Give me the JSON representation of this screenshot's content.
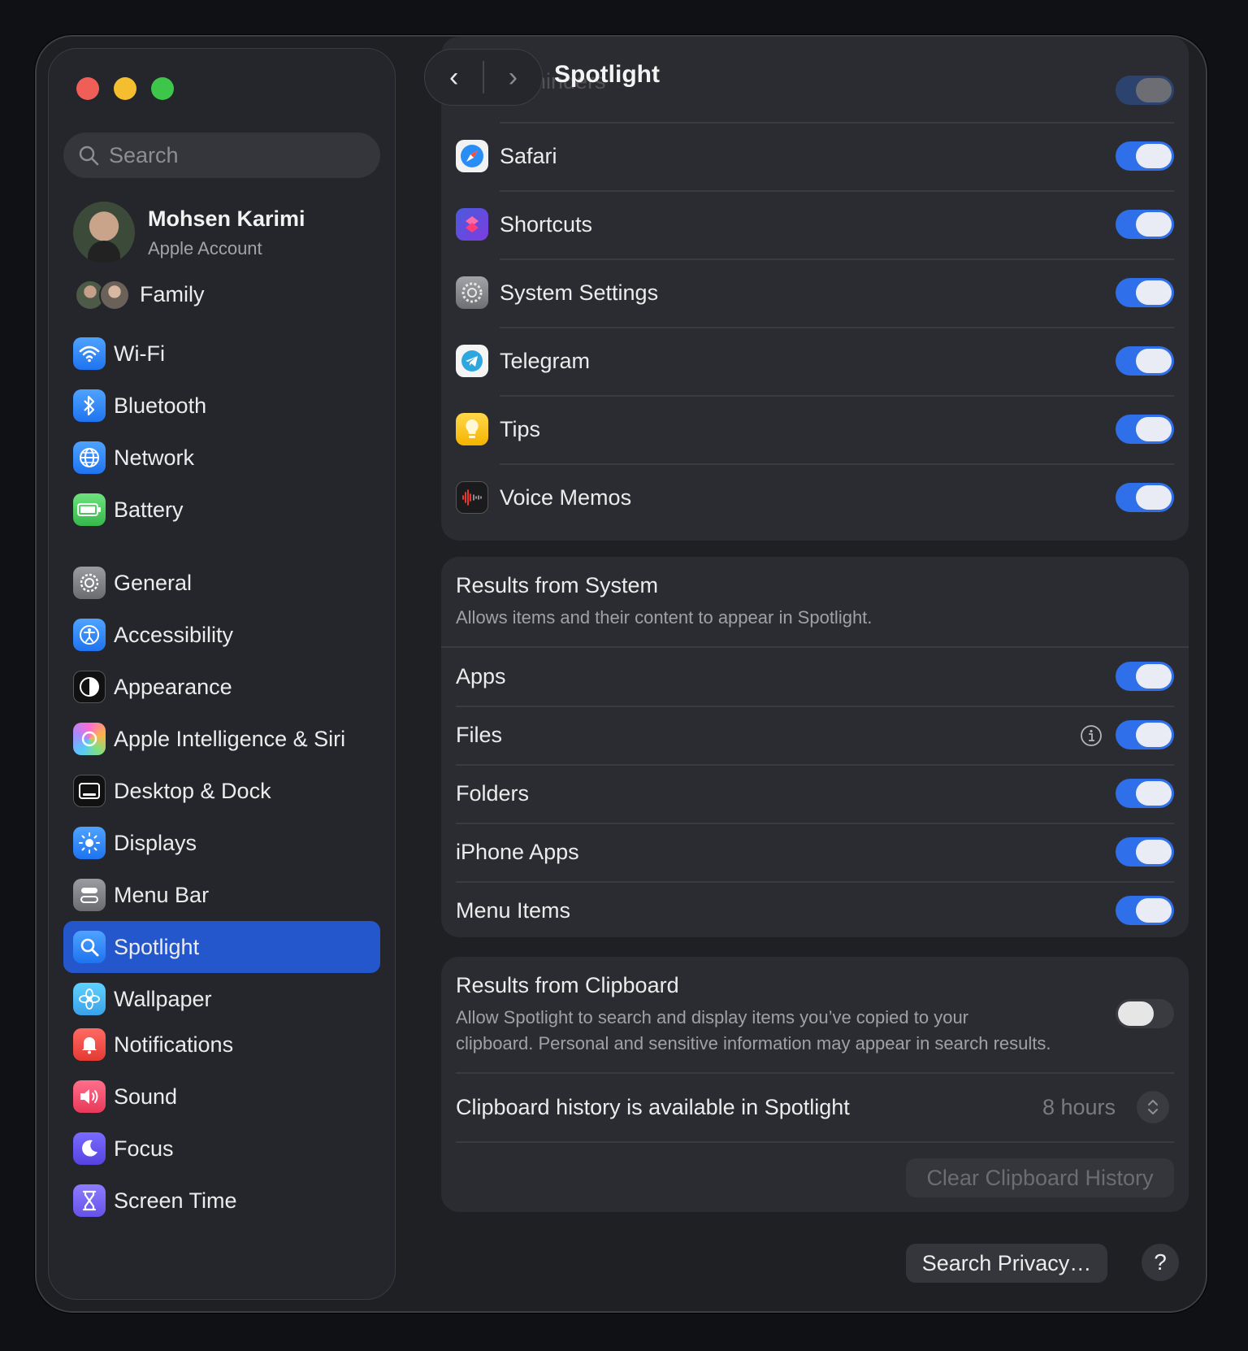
{
  "window": {
    "title": "Spotlight",
    "back_glyph": "‹",
    "forward_glyph": "›"
  },
  "sidebar": {
    "search_placeholder": "Search",
    "account": {
      "name": "Mohsen Karimi",
      "subtitle": "Apple Account"
    },
    "family_label": "Family",
    "groups": [
      [
        {
          "label": "Wi-Fi",
          "icon": "wifi-icon"
        },
        {
          "label": "Bluetooth",
          "icon": "bluetooth-icon"
        },
        {
          "label": "Network",
          "icon": "globe-icon"
        },
        {
          "label": "Battery",
          "icon": "battery-icon"
        }
      ],
      [
        {
          "label": "General",
          "icon": "gear-icon"
        },
        {
          "label": "Accessibility",
          "icon": "accessibility-icon"
        },
        {
          "label": "Appearance",
          "icon": "appearance-icon"
        },
        {
          "label": "Apple Intelligence & Siri",
          "icon": "siri-icon"
        },
        {
          "label": "Desktop & Dock",
          "icon": "dock-icon"
        },
        {
          "label": "Displays",
          "icon": "sun-icon"
        },
        {
          "label": "Menu Bar",
          "icon": "menubar-icon"
        },
        {
          "label": "Spotlight",
          "icon": "magnifier-icon",
          "active": true
        },
        {
          "label": "Wallpaper",
          "icon": "flower-icon"
        }
      ],
      [
        {
          "label": "Notifications",
          "icon": "bell-icon"
        },
        {
          "label": "Sound",
          "icon": "speaker-icon"
        },
        {
          "label": "Focus",
          "icon": "moon-icon"
        },
        {
          "label": "Screen Time",
          "icon": "hourglass-icon"
        }
      ]
    ]
  },
  "apps": {
    "partial_row": "Reminders",
    "items": [
      {
        "label": "Safari",
        "on": true,
        "icon": "safari-icon"
      },
      {
        "label": "Shortcuts",
        "on": true,
        "icon": "shortcuts-icon"
      },
      {
        "label": "System Settings",
        "on": true,
        "icon": "system-settings-icon"
      },
      {
        "label": "Telegram",
        "on": true,
        "icon": "telegram-icon"
      },
      {
        "label": "Tips",
        "on": true,
        "icon": "tips-icon"
      },
      {
        "label": "Voice Memos",
        "on": true,
        "icon": "voice-memos-icon"
      }
    ]
  },
  "system": {
    "title": "Results from System",
    "subtitle": "Allows items and their content to appear in Spotlight.",
    "items": [
      {
        "label": "Apps",
        "on": true
      },
      {
        "label": "Files",
        "on": true,
        "info": true
      },
      {
        "label": "Folders",
        "on": true
      },
      {
        "label": "iPhone Apps",
        "on": true
      },
      {
        "label": "Menu Items",
        "on": true
      }
    ]
  },
  "clipboard": {
    "title": "Results from Clipboard",
    "subtitle_line1": "Allow Spotlight to search and display items you’ve copied to your",
    "subtitle_line2": "clipboard. Personal and sensitive information may appear in search results.",
    "enabled": false,
    "history_label": "Clipboard history is available in Spotlight",
    "history_value": "8 hours",
    "clear_button": "Clear Clipboard History"
  },
  "footer": {
    "privacy_button": "Search Privacy…",
    "help_button": "?"
  },
  "colors": {
    "accent": "#2f6fe9",
    "sidebar_active": "#2457cc",
    "window_bg": "#1f2024",
    "card_bg": "#2b2c31"
  }
}
